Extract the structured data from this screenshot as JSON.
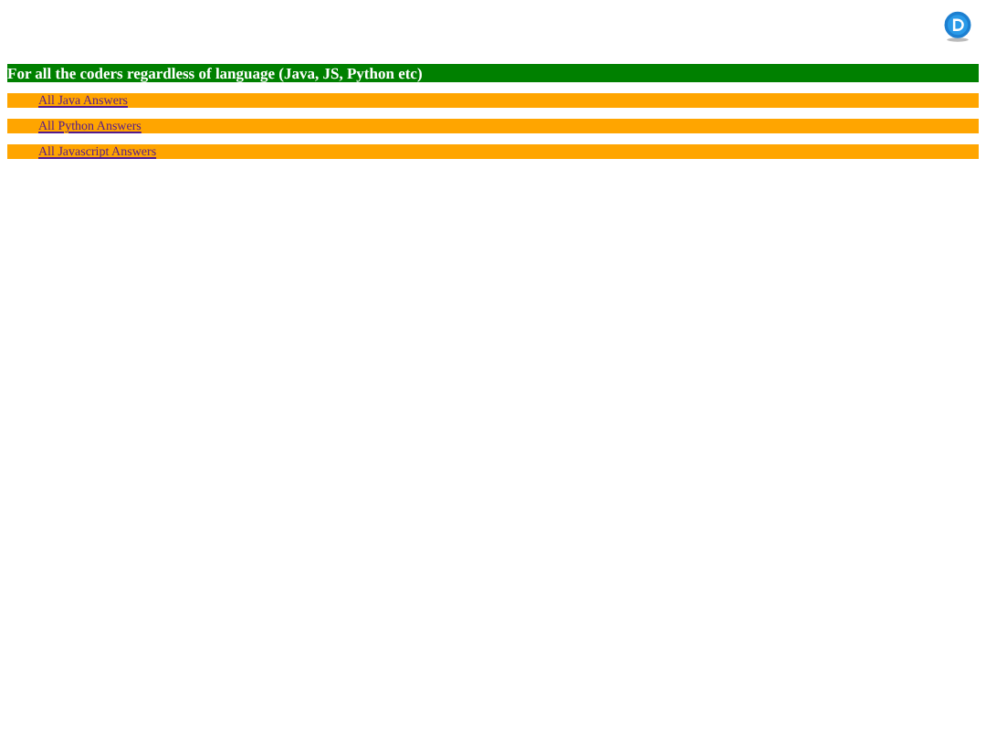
{
  "header": {
    "title": "For all the coders regardless of language (Java, JS, Python etc)"
  },
  "links": [
    {
      "label": "All Java Answers"
    },
    {
      "label": "All Python Answers"
    },
    {
      "label": "All Javascript Answers"
    }
  ]
}
